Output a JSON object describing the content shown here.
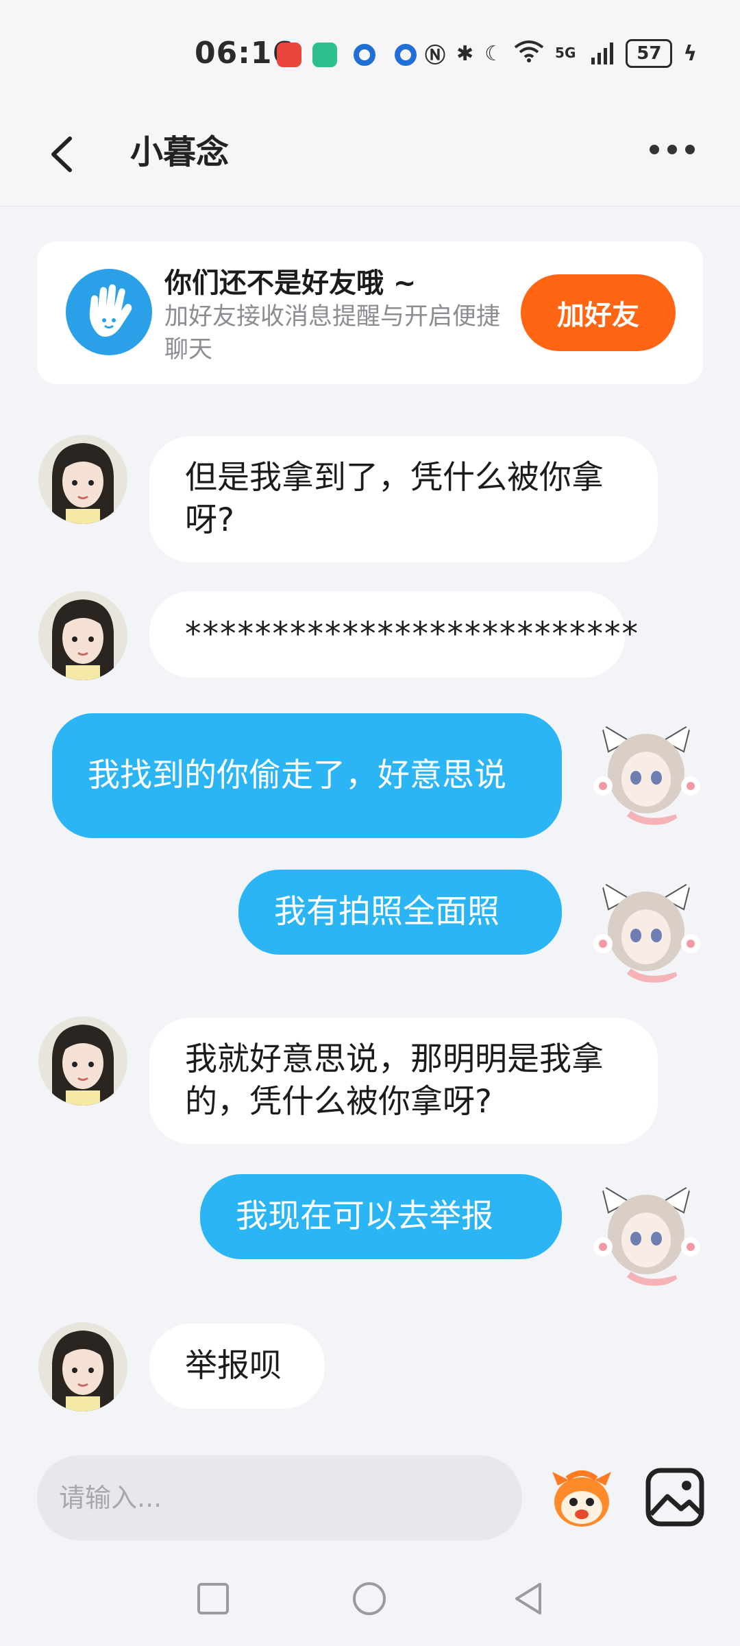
{
  "status_bar": {
    "time": "06:16",
    "signal_label": "5G",
    "battery": "57"
  },
  "header": {
    "back_icon": "chevron-left-icon",
    "title": "小暮念",
    "more_icon": "more-horizontal-icon"
  },
  "friend_prompt": {
    "title": "你们还不是好友哦 ~",
    "subtitle": "加好友接收消息提醒与开启便捷聊天",
    "button": "加好友",
    "accent": "#ff6513"
  },
  "messages": [
    {
      "side": "in",
      "text": "但是我拿到了，凭什么被你拿呀?"
    },
    {
      "side": "in",
      "text": "**************************"
    },
    {
      "side": "out",
      "text": "我找到的你偷走了，好意思说"
    },
    {
      "side": "out",
      "text": "我有拍照全面照"
    },
    {
      "side": "in",
      "text": "我就好意思说，那明明是我拿的，凭什么被你拿呀?"
    },
    {
      "side": "out",
      "text": "我现在可以去举报"
    },
    {
      "side": "in",
      "text": "举报呗"
    }
  ],
  "composer": {
    "placeholder": "请输入...",
    "emoji_icon": "mascot-emoji-icon",
    "image_icon": "image-icon"
  },
  "colors": {
    "outgoing_bubble": "#2cb5f5",
    "incoming_bubble": "#ffffff",
    "background": "#f3f4f8"
  }
}
